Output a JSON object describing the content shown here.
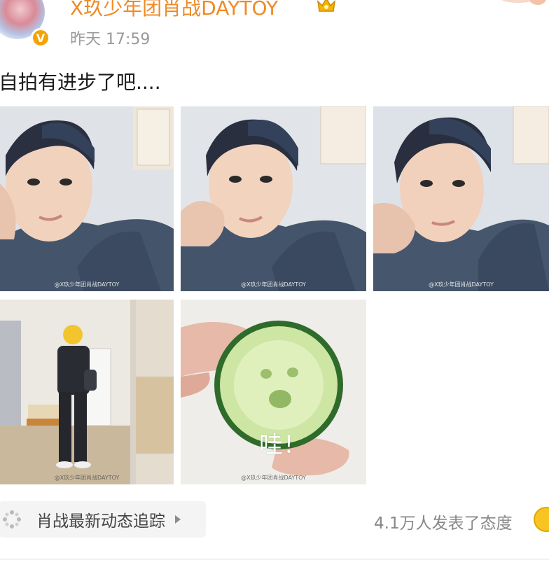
{
  "post": {
    "author": "X玖少年团肖战DAYTOY",
    "time": "昨天 17:59",
    "text": "自拍有进步了吧....",
    "verified_badge": "V",
    "images": [
      {
        "icon": "selfie-photo-1",
        "watermark": "@X玖少年团肖战DAYTOY"
      },
      {
        "icon": "selfie-photo-2",
        "watermark": "@X玖少年团肖战DAYTOY"
      },
      {
        "icon": "selfie-photo-3",
        "watermark": "@X玖少年团肖战DAYTOY"
      },
      {
        "icon": "mirror-photo",
        "watermark": "@X玖少年团肖战DAYTOY"
      },
      {
        "icon": "cucumber-photo",
        "watermark": "@X玖少年团肖战DAYTOY",
        "caption": "哇！"
      }
    ]
  },
  "footer": {
    "topic": "肖战最新动态追踪",
    "reactions": "4.1万人发表了态度"
  },
  "colors": {
    "author_orange": "#f08a24",
    "badge_gold": "#f5a300",
    "muted_gray": "#9a9a9a"
  }
}
